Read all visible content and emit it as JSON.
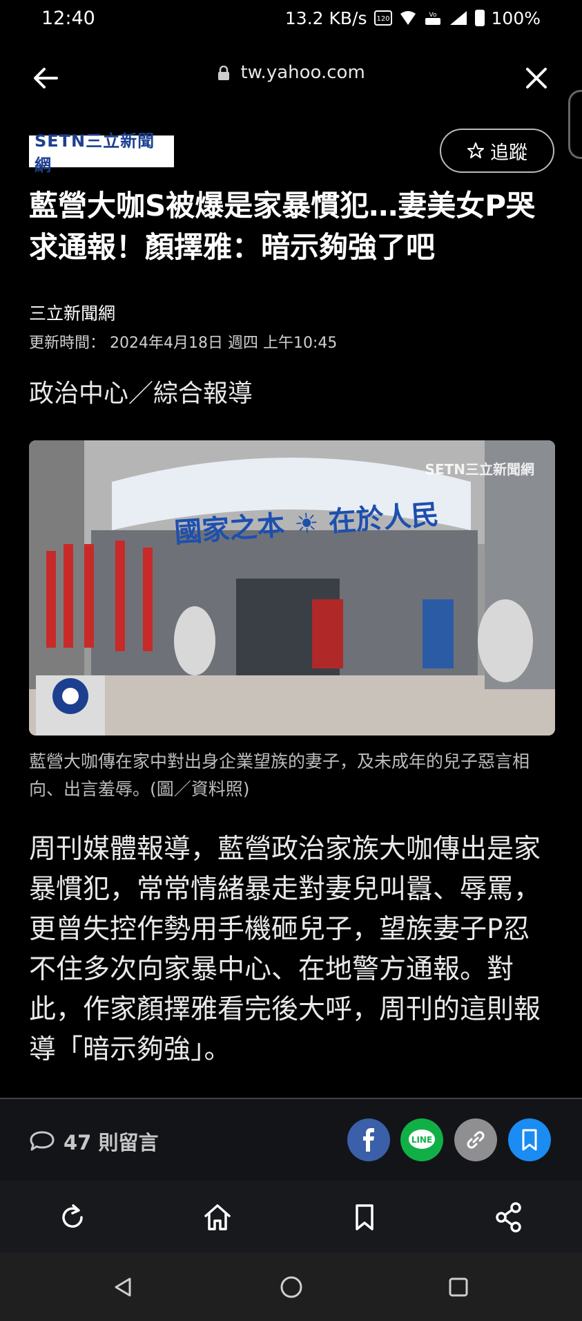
{
  "status_bar": {
    "time": "12:40",
    "network_speed": "13.2 KB/s",
    "battery": "100%",
    "icons": [
      "hz-120-icon",
      "wifi-icon",
      "volte-icon",
      "signal-icon",
      "battery-icon"
    ]
  },
  "browser": {
    "url": "tw.yahoo.com",
    "back_icon": "back-arrow-icon",
    "close_icon": "close-icon"
  },
  "article": {
    "publisher_logo": "SETN三立新聞網",
    "follow_label": "追蹤",
    "headline": "藍營大咖S被爆是家暴慣犯…妻美女P哭求通報！顏擇雅：暗示夠強了吧",
    "source": "三立新聞網",
    "updated": "更新時間： 2024年4月18日 週四 上午10:45",
    "department": "政治中心／綜合報導",
    "photo": {
      "banner": "國家之本 ☀ 在於人民",
      "watermark": "SETN三立新聞網"
    },
    "caption": "藍營大咖傳在家中對出身企業望族的妻子，及未成年的兒子惡言相向、出言羞辱。(圖／資料照)",
    "body": "周刊媒體報導，藍營政治家族大咖傳出是家暴慣犯，常常情緒暴走對妻兒叫囂、辱罵，更曾失控作勢用手機砸兒子，望族妻子P忍不住多次向家暴中心、在地警方通報。對此，作家顏擇雅看完後大呼，周刊的這則報導「暗示夠強」。"
  },
  "comment_bar": {
    "comments_label": "47 則留言",
    "share_buttons": [
      "facebook-icon",
      "line-icon",
      "link-icon",
      "bookmark-icon"
    ]
  },
  "toolbar": {
    "items": [
      "reload-icon",
      "home-icon",
      "bookmark-icon",
      "share-icon"
    ]
  },
  "android_nav": {
    "items": [
      "back-triangle-icon",
      "home-circle-icon",
      "recents-square-icon"
    ]
  },
  "colors": {
    "background": "#000000",
    "facebook": "#3b5fa8",
    "line": "#11b046",
    "link": "#8f8f92",
    "save": "#1a8cf2"
  }
}
